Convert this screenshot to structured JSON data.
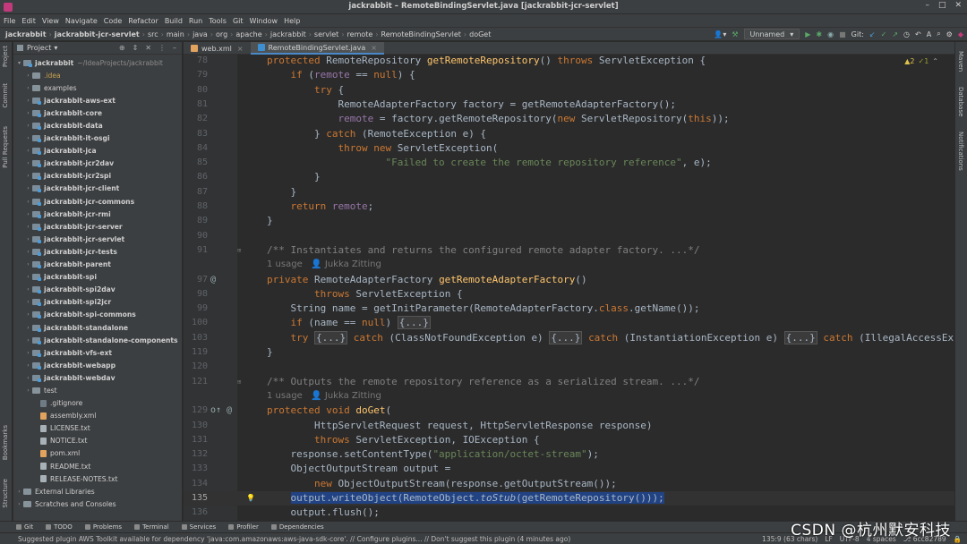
{
  "window": {
    "title": "jackrabbit – RemoteBindingServlet.java [jackrabbit-jcr-servlet]",
    "controls": [
      "–",
      "□",
      "✕"
    ]
  },
  "menu": [
    "File",
    "Edit",
    "View",
    "Navigate",
    "Code",
    "Refactor",
    "Build",
    "Run",
    "Tools",
    "Git",
    "Window",
    "Help"
  ],
  "breadcrumbs": [
    "jackrabbit",
    "jackrabbit-jcr-servlet",
    "src",
    "main",
    "java",
    "org",
    "apache",
    "jackrabbit",
    "servlet",
    "remote",
    "RemoteBindingServlet",
    "doGet"
  ],
  "toolbar": {
    "run_config": "Unnamed",
    "git_label": "Git:"
  },
  "left_stripe": [
    "Project",
    "Commit",
    "Pull Requests",
    "Bookmarks",
    "Structure"
  ],
  "right_stripe": [
    "Maven",
    "Database",
    "Notifications"
  ],
  "project": {
    "header": "Project",
    "root": {
      "name": "jackrabbit",
      "path": "~/IdeaProjects/jackrabbit"
    },
    "items": [
      {
        "name": ".idea",
        "kind": "folder",
        "style": "yellow"
      },
      {
        "name": "examples",
        "kind": "folder",
        "style": "normal"
      },
      {
        "name": "jackrabbit-aws-ext",
        "kind": "module",
        "style": "bold"
      },
      {
        "name": "jackrabbit-core",
        "kind": "module",
        "style": "bold"
      },
      {
        "name": "jackrabbit-data",
        "kind": "module",
        "style": "bold"
      },
      {
        "name": "jackrabbit-it-osgi",
        "kind": "module",
        "style": "bold"
      },
      {
        "name": "jackrabbit-jca",
        "kind": "module",
        "style": "bold"
      },
      {
        "name": "jackrabbit-jcr2dav",
        "kind": "module",
        "style": "bold"
      },
      {
        "name": "jackrabbit-jcr2spi",
        "kind": "module",
        "style": "bold"
      },
      {
        "name": "jackrabbit-jcr-client",
        "kind": "module",
        "style": "bold"
      },
      {
        "name": "jackrabbit-jcr-commons",
        "kind": "module",
        "style": "bold"
      },
      {
        "name": "jackrabbit-jcr-rmi",
        "kind": "module",
        "style": "bold"
      },
      {
        "name": "jackrabbit-jcr-server",
        "kind": "module",
        "style": "bold"
      },
      {
        "name": "jackrabbit-jcr-servlet",
        "kind": "module",
        "style": "bold"
      },
      {
        "name": "jackrabbit-jcr-tests",
        "kind": "module",
        "style": "bold"
      },
      {
        "name": "jackrabbit-parent",
        "kind": "module",
        "style": "bold"
      },
      {
        "name": "jackrabbit-spi",
        "kind": "module",
        "style": "bold"
      },
      {
        "name": "jackrabbit-spi2dav",
        "kind": "module",
        "style": "bold"
      },
      {
        "name": "jackrabbit-spi2jcr",
        "kind": "module",
        "style": "bold"
      },
      {
        "name": "jackrabbit-spi-commons",
        "kind": "module",
        "style": "bold"
      },
      {
        "name": "jackrabbit-standalone",
        "kind": "module",
        "style": "bold"
      },
      {
        "name": "jackrabbit-standalone-components",
        "kind": "module",
        "style": "bold"
      },
      {
        "name": "jackrabbit-vfs-ext",
        "kind": "module",
        "style": "bold"
      },
      {
        "name": "jackrabbit-webapp",
        "kind": "module",
        "style": "bold"
      },
      {
        "name": "jackrabbit-webdav",
        "kind": "module",
        "style": "bold"
      },
      {
        "name": "test",
        "kind": "folder",
        "style": "normal"
      },
      {
        "name": ".gitignore",
        "kind": "git",
        "style": "normal"
      },
      {
        "name": "assembly.xml",
        "kind": "xml",
        "style": "normal"
      },
      {
        "name": "LICENSE.txt",
        "kind": "txt",
        "style": "normal"
      },
      {
        "name": "NOTICE.txt",
        "kind": "txt",
        "style": "normal"
      },
      {
        "name": "pom.xml",
        "kind": "xml",
        "style": "normal"
      },
      {
        "name": "README.txt",
        "kind": "txt",
        "style": "normal"
      },
      {
        "name": "RELEASE-NOTES.txt",
        "kind": "txt",
        "style": "normal"
      }
    ],
    "external": "External Libraries",
    "scratches": "Scratches and Consoles"
  },
  "tabs": [
    {
      "label": "web.xml",
      "active": false
    },
    {
      "label": "RemoteBindingServlet.java",
      "active": true
    }
  ],
  "inspections": {
    "warnings": "▲2",
    "weak": "✓1"
  },
  "code": [
    {
      "ln": "78",
      "html": "    <span class='k'>protected</span> RemoteRepository <span class='f'>getRemoteRepository</span>() <span class='k'>throws</span> ServletException {"
    },
    {
      "ln": "79",
      "html": "        <span class='k'>if</span> (<span class='fld'>remote</span> == <span class='k'>null</span>) {"
    },
    {
      "ln": "80",
      "html": "            <span class='k'>try</span> {"
    },
    {
      "ln": "81",
      "html": "                RemoteAdapterFactory factory = getRemoteAdapterFactory();"
    },
    {
      "ln": "82",
      "html": "                <span class='fld'>remote</span> = factory.getRemoteRepository(<span class='k'>new</span> ServletRepository(<span class='k'>this</span>));"
    },
    {
      "ln": "83",
      "html": "            } <span class='k'>catch</span> (RemoteException e) {"
    },
    {
      "ln": "84",
      "html": "                <span class='k'>throw new</span> ServletException("
    },
    {
      "ln": "85",
      "html": "                        <span class='s'>\"Failed to create the remote repository reference\"</span>, e);"
    },
    {
      "ln": "86",
      "html": "            }"
    },
    {
      "ln": "87",
      "html": "        }"
    },
    {
      "ln": "88",
      "html": "        <span class='k'>return</span> <span class='fld'>remote</span>;"
    },
    {
      "ln": "89",
      "html": "    }"
    },
    {
      "ln": "90",
      "html": ""
    },
    {
      "ln": "91",
      "html": "    <span class='c'>/** Instantiates and returns the configured remote adapter factory. ...*/</span>",
      "fold": true
    },
    {
      "ln": "",
      "hint": "1 usage   👤 Jukka Zitting"
    },
    {
      "ln": "97",
      "html": "    <span class='k'>private</span> RemoteAdapterFactory <span class='f'>getRemoteAdapterFactory</span>()",
      "mark": "@"
    },
    {
      "ln": "98",
      "html": "            <span class='k'>throws</span> ServletException {"
    },
    {
      "ln": "99",
      "html": "        String name = getInitParameter(RemoteAdapterFactory.<span class='k'>class</span>.getName());"
    },
    {
      "ln": "100",
      "html": "        <span class='k'>if</span> (name == <span class='k'>null</span>) <span class='fold'>{...}</span>"
    },
    {
      "ln": "103",
      "html": "        <span class='k'>try</span> <span class='fold'>{...}</span> <span class='k'>catch</span> (ClassNotFoundException e) <span class='fold'>{...}</span> <span class='k'>catch</span> (InstantiationException e) <span class='fold'>{...}</span> <span class='k'>catch</span> (IllegalAccessEx"
    },
    {
      "ln": "119",
      "html": "    }"
    },
    {
      "ln": "120",
      "html": ""
    },
    {
      "ln": "121",
      "html": "    <span class='c'>/** Outputs the remote repository reference as a serialized stream. ...*/</span>",
      "fold": true
    },
    {
      "ln": "",
      "hint": "1 usage   👤 Jukka Zitting"
    },
    {
      "ln": "129",
      "html": "    <span class='k'>protected void</span> <span class='f'>doGet</span>(",
      "mark": "o↑ @"
    },
    {
      "ln": "130",
      "html": "            HttpServletRequest request, HttpServletResponse response)"
    },
    {
      "ln": "131",
      "html": "            <span class='k'>throws</span> ServletException, IOException {"
    },
    {
      "ln": "132",
      "html": "        response.setContentType(<span class='s'>\"application/octet-stream\"</span>);"
    },
    {
      "ln": "133",
      "html": "        ObjectOutputStream output ="
    },
    {
      "ln": "134",
      "html": "            <span class='k'>new</span> ObjectOutputStream(response.getOutputStream());"
    },
    {
      "ln": "135",
      "html": "        <span class='selected'>output.writeObject(RemoteObject.<i>toStub</i>(getRemoteRepository()));</span>",
      "current": true,
      "bulb": true
    },
    {
      "ln": "136",
      "html": "        output.flush();"
    }
  ],
  "bottom_tools": [
    "Git",
    "TODO",
    "Problems",
    "Terminal",
    "Services",
    "Profiler",
    "Dependencies"
  ],
  "status": {
    "message": "Suggested plugin AWS Toolkit available for dependency 'java:com.amazonaws:aws-java-sdk-core'. // Configure plugins... // Don't suggest this plugin (4 minutes ago)",
    "position": "135:9 (63 chars)",
    "line_sep": "LF",
    "encoding": "UTF-8",
    "indent": "4 spaces",
    "vcs": "⎇ 6cc82789"
  },
  "watermark": "CSDN @杭州默安科技"
}
